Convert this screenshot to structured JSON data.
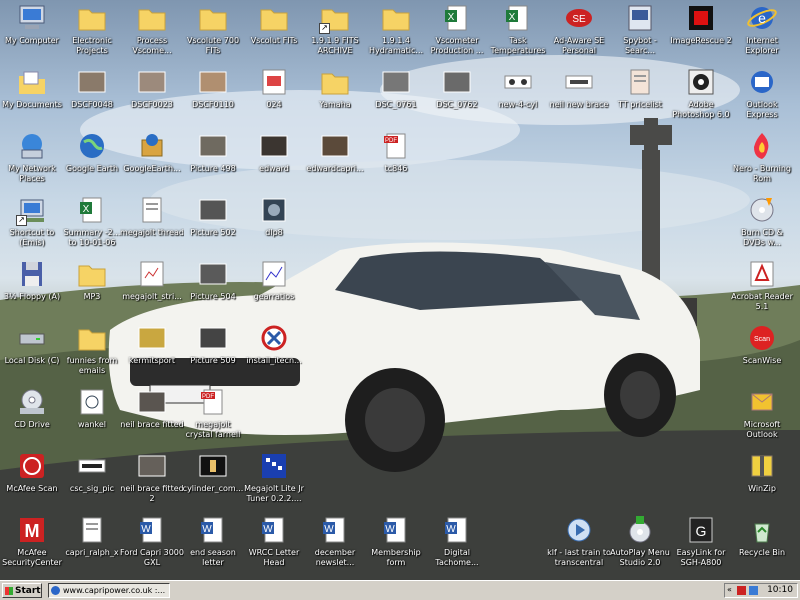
{
  "colors": {
    "taskbar": "#d4d0c8",
    "label": "#ffffff",
    "sky": "#a9bfd6"
  },
  "desktop_icons": [
    {
      "label": "My Computer",
      "icon": "computer-icon"
    },
    {
      "label": "Electronic Projects",
      "icon": "folder-icon"
    },
    {
      "label": "Process Vscome...",
      "icon": "folder-icon"
    },
    {
      "label": "Vscolute 700 FITs",
      "icon": "folder-icon"
    },
    {
      "label": "Vscolut FITs",
      "icon": "folder-icon"
    },
    {
      "label": "1.9.1.9 FITS ARCHIVE",
      "icon": "folder-icon"
    },
    {
      "label": "1.9.1.4 Hydramatic...",
      "icon": "folder-icon"
    },
    {
      "label": "Vscometer Production ...",
      "icon": "excel-icon"
    },
    {
      "label": "Task Temperatures",
      "icon": "excel-icon"
    },
    {
      "label": "Ad-Aware SE Personal",
      "icon": "adaware-icon"
    },
    {
      "label": "Spybot - Searc...",
      "icon": "spybot-icon"
    },
    {
      "label": "ImageRescue 2",
      "icon": "imagerescue-icon"
    },
    {
      "label": "Internet Explorer",
      "icon": "ie-icon"
    },
    {
      "label": "My Documents",
      "icon": "documents-icon"
    },
    {
      "label": "DSCF0048",
      "icon": "photo-icon"
    },
    {
      "label": "DSCF0023",
      "icon": "photo-icon"
    },
    {
      "label": "DSCF0110",
      "icon": "photo-icon"
    },
    {
      "label": "024",
      "icon": "image-file-icon"
    },
    {
      "label": "Yamaha",
      "icon": "folder-icon"
    },
    {
      "label": "DSC_0761",
      "icon": "photo-icon"
    },
    {
      "label": "DSC_0762",
      "icon": "photo-icon"
    },
    {
      "label": "new-4-cyl",
      "icon": "photo-icon"
    },
    {
      "label": "neil new brace",
      "icon": "photo-icon"
    },
    {
      "label": "TT pricelist",
      "icon": "document-icon"
    },
    {
      "label": "Adobe Photoshop 6.0",
      "icon": "photoshop-icon"
    },
    {
      "label": "Outlook Express",
      "icon": "outlook-express-icon"
    },
    {
      "label": "My Network Places",
      "icon": "network-icon"
    },
    {
      "label": "Google Earth",
      "icon": "globe-icon"
    },
    {
      "label": "GoogleEarth...",
      "icon": "package-icon"
    },
    {
      "label": "Picture 498",
      "icon": "photo-icon"
    },
    {
      "label": "edward",
      "icon": "photo-icon"
    },
    {
      "label": "edwardcapri...",
      "icon": "photo-icon"
    },
    {
      "label": "tc846",
      "icon": "pdf-icon"
    },
    {
      "label": "Nero - Burning Rom",
      "icon": "nero-icon"
    },
    {
      "label": "Shortcut to (Emis)",
      "icon": "network-shortcut-icon"
    },
    {
      "label": "Summary -2... to 10-01-06",
      "icon": "excel-icon"
    },
    {
      "label": "megajolt thread",
      "icon": "document-icon"
    },
    {
      "label": "Picture 502",
      "icon": "photo-icon"
    },
    {
      "label": "dlp8",
      "icon": "video-icon"
    },
    {
      "label": "Burn CD & DVDs w...",
      "icon": "burn-cd-icon"
    },
    {
      "label": "3½ Floppy (A)",
      "icon": "floppy-icon"
    },
    {
      "label": "MP3",
      "icon": "folder-icon"
    },
    {
      "label": "megajolt_stri...",
      "icon": "image-file-icon"
    },
    {
      "label": "Picture 504",
      "icon": "photo-icon"
    },
    {
      "label": "gearratios",
      "icon": "image-file-icon"
    },
    {
      "label": "Acrobat Reader 5.1",
      "icon": "acrobat-icon"
    },
    {
      "label": "Local Disk (C)",
      "icon": "disk-icon"
    },
    {
      "label": "funnies from emails",
      "icon": "folder-icon"
    },
    {
      "label": "kermitsport",
      "icon": "photo-icon"
    },
    {
      "label": "Picture 509",
      "icon": "photo-icon"
    },
    {
      "label": "install_itecn...",
      "icon": "installer-icon"
    },
    {
      "label": "ScanWise",
      "icon": "scanwise-icon"
    },
    {
      "label": "CD Drive",
      "icon": "cd-drive-icon"
    },
    {
      "label": "wankel",
      "icon": "image-file-icon"
    },
    {
      "label": "neil brace fitted",
      "icon": "photo-icon"
    },
    {
      "label": "megajolt crystal farnell",
      "icon": "pdf-icon"
    },
    {
      "label": "Microsoft Outlook",
      "icon": "outlook-icon"
    },
    {
      "label": "McAfee Scan",
      "icon": "mcafee-scan-icon"
    },
    {
      "label": "csc_sig_pic",
      "icon": "image-file-icon"
    },
    {
      "label": "neil brace fitted 2",
      "icon": "photo-icon"
    },
    {
      "label": "cylinder_com...",
      "icon": "video-icon"
    },
    {
      "label": "Megajolt Lite Jr Tuner 0.2.2....",
      "icon": "megajolt-icon"
    },
    {
      "label": "WinZip",
      "icon": "winzip-icon"
    },
    {
      "label": "McAfee SecurityCenter",
      "icon": "mcafee-icon"
    },
    {
      "label": "capri_ralph_x",
      "icon": "document-icon"
    },
    {
      "label": "Ford Capri 3000 GXL",
      "icon": "word-icon"
    },
    {
      "label": "end season letter",
      "icon": "word-icon"
    },
    {
      "label": "WRCC Letter Head",
      "icon": "word-icon"
    },
    {
      "label": "december newslet...",
      "icon": "word-icon"
    },
    {
      "label": "Membership form",
      "icon": "word-icon"
    },
    {
      "label": "Digital Tachome...",
      "icon": "word-icon"
    },
    {
      "label": "klf - last train to transcentral",
      "icon": "media-icon"
    },
    {
      "label": "AutoPlay Menu Studio 2.0",
      "icon": "autoplay-icon"
    },
    {
      "label": "EasyLink for SGH-A800",
      "icon": "easylink-icon"
    },
    {
      "label": "Recycle Bin",
      "icon": "recycle-bin-icon"
    }
  ],
  "taskbar": {
    "start_label": "Start",
    "task_button": "www.capripower.co.uk :...",
    "tray_chevron": "«",
    "clock": "10:10"
  }
}
